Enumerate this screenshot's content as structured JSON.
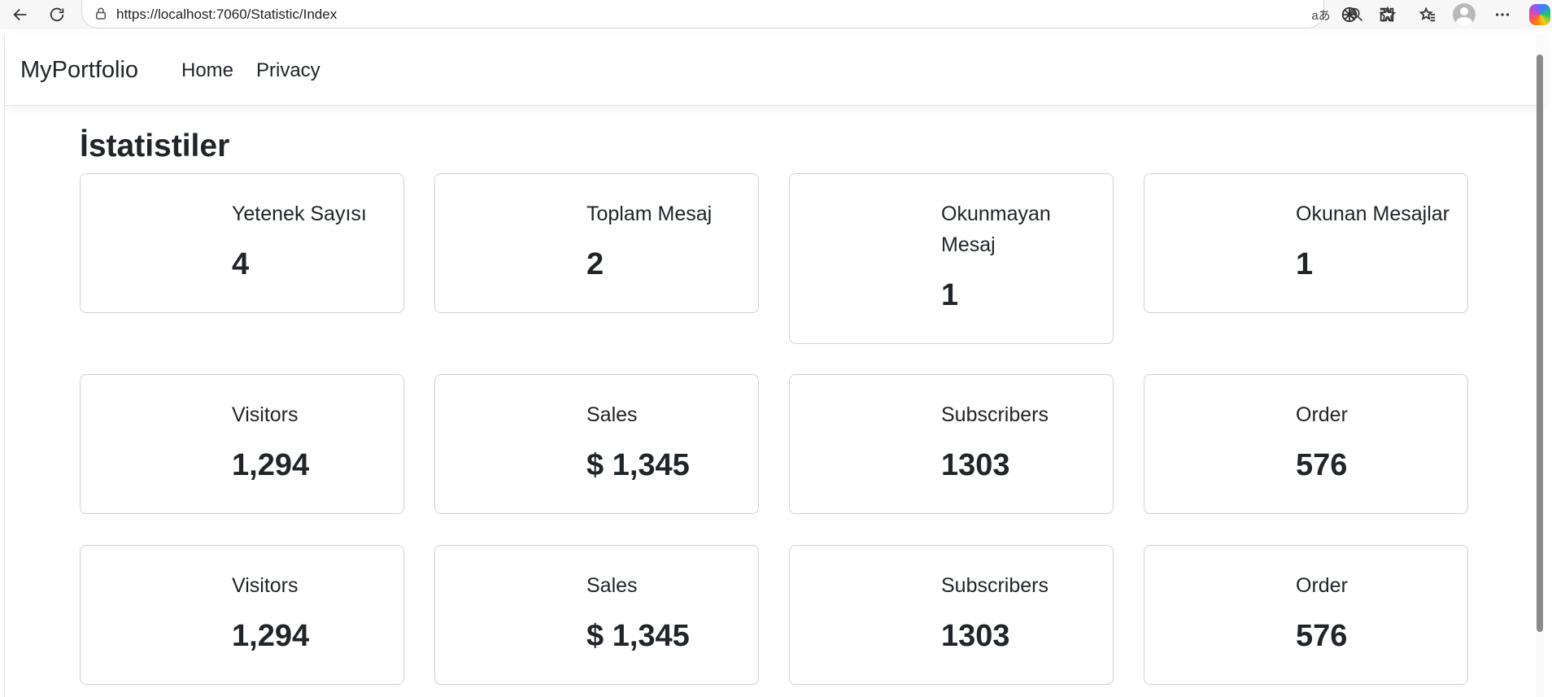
{
  "browser": {
    "url": "https://localhost:7060/Statistic/Index",
    "translate_label": "aあ"
  },
  "navbar": {
    "brand": "MyPortfolio",
    "links": [
      "Home",
      "Privacy"
    ]
  },
  "page": {
    "title": "İstatistiler"
  },
  "stats_row1": [
    {
      "title": "Yetenek Sayısı",
      "value": "4"
    },
    {
      "title": "Toplam Mesaj",
      "value": "2"
    },
    {
      "title": "Okunmayan Mesaj",
      "value": "1"
    },
    {
      "title": "Okunan Mesajlar",
      "value": "1"
    }
  ],
  "stats_row2": [
    {
      "title": "Visitors",
      "value": "1,294"
    },
    {
      "title": "Sales",
      "value": "$ 1,345"
    },
    {
      "title": "Subscribers",
      "value": "1303"
    },
    {
      "title": "Order",
      "value": "576"
    }
  ],
  "stats_row3": [
    {
      "title": "Visitors",
      "value": "1,294"
    },
    {
      "title": "Sales",
      "value": "$ 1,345"
    },
    {
      "title": "Subscribers",
      "value": "1303"
    },
    {
      "title": "Order",
      "value": "576"
    }
  ]
}
